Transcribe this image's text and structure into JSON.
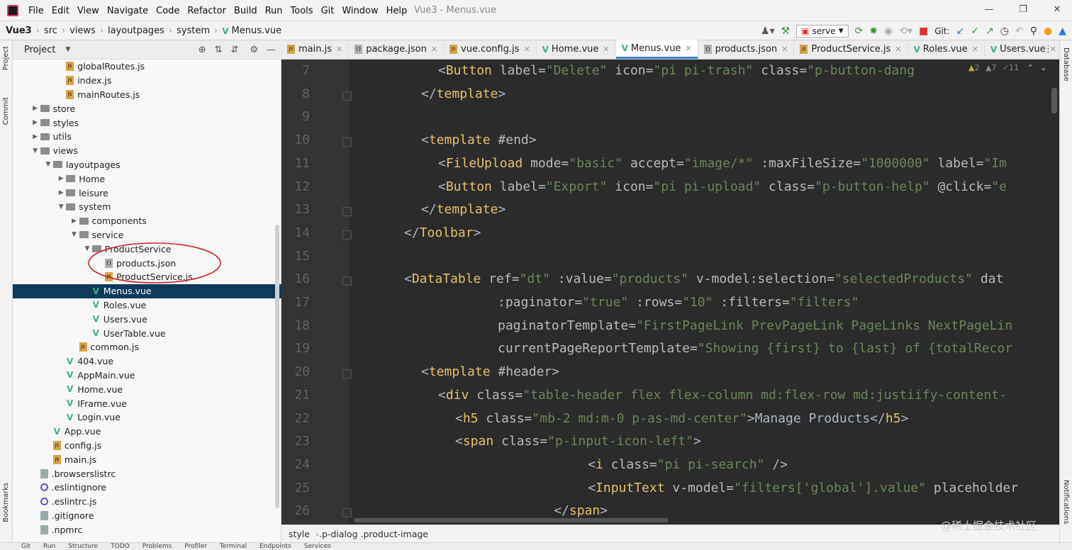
{
  "app": {
    "menu": [
      "File",
      "Edit",
      "View",
      "Navigate",
      "Code",
      "Refactor",
      "Build",
      "Run",
      "Tools",
      "Git",
      "Window",
      "Help"
    ],
    "window_title": "Vue3 - Menus.vue",
    "window_controls": [
      "minimize-icon",
      "restore-icon",
      "close-icon"
    ]
  },
  "breadcrumb": [
    "Vue3",
    "src",
    "views",
    "layoutpages",
    "system",
    "Menus.vue"
  ],
  "toolbar": {
    "run_config": "serve",
    "git_label": "Git:"
  },
  "project_panel": {
    "title": "Project",
    "tree": [
      {
        "label": "globalRoutes.js",
        "type": "js",
        "depth": 4
      },
      {
        "label": "index.js",
        "type": "js",
        "depth": 4
      },
      {
        "label": "mainRoutes.js",
        "type": "js",
        "depth": 4
      },
      {
        "label": "store",
        "type": "folder",
        "depth": 2,
        "expanded": false
      },
      {
        "label": "styles",
        "type": "folder",
        "depth": 2,
        "expanded": false
      },
      {
        "label": "utils",
        "type": "folder",
        "depth": 2,
        "expanded": false
      },
      {
        "label": "views",
        "type": "folder",
        "depth": 2,
        "expanded": true
      },
      {
        "label": "layoutpages",
        "type": "folder",
        "depth": 3,
        "expanded": true
      },
      {
        "label": "Home",
        "type": "folder",
        "depth": 4,
        "expanded": false
      },
      {
        "label": "leisure",
        "type": "folder",
        "depth": 4,
        "expanded": false
      },
      {
        "label": "system",
        "type": "folder",
        "depth": 4,
        "expanded": true
      },
      {
        "label": "components",
        "type": "folder",
        "depth": 5,
        "expanded": false
      },
      {
        "label": "service",
        "type": "folder",
        "depth": 5,
        "expanded": true
      },
      {
        "label": "ProductService",
        "type": "folder",
        "depth": 6,
        "expanded": true
      },
      {
        "label": "products.json",
        "type": "json",
        "depth": 7
      },
      {
        "label": "ProductService.js",
        "type": "js",
        "depth": 7
      },
      {
        "label": "Menus.vue",
        "type": "vue",
        "depth": 6,
        "selected": true
      },
      {
        "label": "Roles.vue",
        "type": "vue",
        "depth": 6
      },
      {
        "label": "Users.vue",
        "type": "vue",
        "depth": 6
      },
      {
        "label": "UserTable.vue",
        "type": "vue",
        "depth": 6
      },
      {
        "label": "common.js",
        "type": "js",
        "depth": 5
      },
      {
        "label": "404.vue",
        "type": "vue",
        "depth": 4
      },
      {
        "label": "AppMain.vue",
        "type": "vue",
        "depth": 4
      },
      {
        "label": "Home.vue",
        "type": "vue",
        "depth": 4
      },
      {
        "label": "IFrame.vue",
        "type": "vue",
        "depth": 4
      },
      {
        "label": "Login.vue",
        "type": "vue",
        "depth": 4
      },
      {
        "label": "App.vue",
        "type": "vue",
        "depth": 3
      },
      {
        "label": "config.js",
        "type": "js",
        "depth": 3
      },
      {
        "label": "main.js",
        "type": "js",
        "depth": 3
      },
      {
        "label": ".browserslistrc",
        "type": "dot",
        "depth": 2
      },
      {
        "label": ".eslintignore",
        "type": "eslint",
        "depth": 2
      },
      {
        "label": ".eslintrc.js",
        "type": "eslint",
        "depth": 2
      },
      {
        "label": ".gitignore",
        "type": "dot",
        "depth": 2
      },
      {
        "label": ".npmrc",
        "type": "dot",
        "depth": 2
      }
    ]
  },
  "tabs": [
    {
      "label": "main.js",
      "type": "js"
    },
    {
      "label": "package.json",
      "type": "json"
    },
    {
      "label": "vue.config.js",
      "type": "js"
    },
    {
      "label": "Home.vue",
      "type": "vue"
    },
    {
      "label": "Menus.vue",
      "type": "vue",
      "active": true
    },
    {
      "label": "products.json",
      "type": "json"
    },
    {
      "label": "ProductService.js",
      "type": "js"
    },
    {
      "label": "Roles.vue",
      "type": "vue"
    },
    {
      "label": "Users.vue",
      "type": "vue"
    }
  ],
  "inspection": {
    "warnings": "2",
    "weak": "7",
    "typos": "11"
  },
  "code_lines": [
    {
      "n": "7",
      "indent": 2,
      "t": [
        [
          "p",
          "<"
        ],
        [
          "tg",
          "Button "
        ],
        [
          "at",
          "label="
        ],
        [
          "st",
          "\"Delete\" "
        ],
        [
          "at",
          "icon="
        ],
        [
          "st",
          "\"pi pi-trash\" "
        ],
        [
          "at",
          "class="
        ],
        [
          "st",
          "\"p-button-dang"
        ]
      ]
    },
    {
      "n": "8",
      "indent": 1,
      "t": [
        [
          "p",
          "</"
        ],
        [
          "tg",
          "template"
        ],
        [
          "p",
          ">"
        ]
      ]
    },
    {
      "n": "9",
      "indent": 0,
      "t": []
    },
    {
      "n": "10",
      "indent": 1,
      "t": [
        [
          "p",
          "<"
        ],
        [
          "tg",
          "template "
        ],
        [
          "at",
          "#end"
        ],
        [
          "p",
          ">"
        ]
      ]
    },
    {
      "n": "11",
      "indent": 2,
      "t": [
        [
          "p",
          "<"
        ],
        [
          "tg",
          "FileUpload "
        ],
        [
          "at",
          "mode="
        ],
        [
          "st",
          "\"basic\" "
        ],
        [
          "at",
          "accept="
        ],
        [
          "st",
          "\"image/*\" "
        ],
        [
          "at",
          ":maxFileSize="
        ],
        [
          "st",
          "\"1000000\" "
        ],
        [
          "at",
          "label="
        ],
        [
          "st",
          "\"Im"
        ]
      ]
    },
    {
      "n": "12",
      "indent": 2,
      "t": [
        [
          "p",
          "<"
        ],
        [
          "tg",
          "Button "
        ],
        [
          "at",
          "label="
        ],
        [
          "st",
          "\"Export\" "
        ],
        [
          "at",
          "icon="
        ],
        [
          "st",
          "\"pi pi-upload\" "
        ],
        [
          "at",
          "class="
        ],
        [
          "st",
          "\"p-button-help\" "
        ],
        [
          "at",
          "@click="
        ],
        [
          "st",
          "\"e"
        ]
      ]
    },
    {
      "n": "13",
      "indent": 1,
      "t": [
        [
          "p",
          "</"
        ],
        [
          "tg",
          "template"
        ],
        [
          "p",
          ">"
        ]
      ]
    },
    {
      "n": "14",
      "indent": 0,
      "t": [
        [
          "p",
          "</"
        ],
        [
          "tg",
          "Toolbar"
        ],
        [
          "p",
          ">"
        ]
      ]
    },
    {
      "n": "15",
      "indent": 0,
      "t": []
    },
    {
      "n": "16",
      "indent": 0,
      "t": [
        [
          "p",
          "<"
        ],
        [
          "tg",
          "DataTable "
        ],
        [
          "at",
          "ref="
        ],
        [
          "st",
          "\"dt\" "
        ],
        [
          "at",
          ":value="
        ],
        [
          "st",
          "\"products\" "
        ],
        [
          "at",
          "v-model"
        ],
        [
          "p",
          ":"
        ],
        [
          "at",
          "selection="
        ],
        [
          "st",
          "\"selectedProducts\" "
        ],
        [
          "at",
          "dat"
        ]
      ]
    },
    {
      "n": "17",
      "indent": 5.5,
      "t": [
        [
          "at",
          ":paginator="
        ],
        [
          "st",
          "\"true\" "
        ],
        [
          "at",
          ":rows="
        ],
        [
          "st",
          "\"10\" "
        ],
        [
          "at",
          ":filters="
        ],
        [
          "st",
          "\"filters\""
        ]
      ]
    },
    {
      "n": "18",
      "indent": 5.5,
      "t": [
        [
          "at",
          "paginatorTemplate="
        ],
        [
          "st",
          "\"FirstPageLink PrevPageLink PageLinks NextPageLin"
        ]
      ]
    },
    {
      "n": "19",
      "indent": 5.5,
      "t": [
        [
          "at",
          "currentPageReportTemplate="
        ],
        [
          "st",
          "\"Showing {first} to {last} of {totalRecor"
        ]
      ]
    },
    {
      "n": "20",
      "indent": 1,
      "t": [
        [
          "p",
          "<"
        ],
        [
          "tg",
          "template "
        ],
        [
          "at",
          "#header"
        ],
        [
          "p",
          ">"
        ]
      ]
    },
    {
      "n": "21",
      "indent": 2,
      "t": [
        [
          "p",
          "<"
        ],
        [
          "tg",
          "div "
        ],
        [
          "at",
          "class="
        ],
        [
          "st",
          "\"table-header flex flex-column md:flex-row md:justiify-content-"
        ]
      ]
    },
    {
      "n": "22",
      "indent": 3,
      "t": [
        [
          "p",
          "<"
        ],
        [
          "tg",
          "h5 "
        ],
        [
          "at",
          "class="
        ],
        [
          "st",
          "\"mb-2 md:m-0 p-as-md-center\""
        ],
        [
          "p",
          ">Manage Products</"
        ],
        [
          "tg",
          "h5"
        ],
        [
          "p",
          ">"
        ]
      ]
    },
    {
      "n": "23",
      "indent": 3,
      "t": [
        [
          "p",
          "<"
        ],
        [
          "tg",
          "span "
        ],
        [
          "at",
          "class="
        ],
        [
          "st",
          "\"p-input-icon-left\""
        ],
        [
          "p",
          ">"
        ]
      ]
    },
    {
      "n": "24",
      "indent": 10.8,
      "t": [
        [
          "p",
          "<"
        ],
        [
          "tg",
          "i "
        ],
        [
          "at",
          "class="
        ],
        [
          "st",
          "\"pi pi-search\" "
        ],
        [
          "p",
          "/>"
        ]
      ]
    },
    {
      "n": "25",
      "indent": 10.8,
      "t": [
        [
          "p",
          "<"
        ],
        [
          "tg",
          "InputText "
        ],
        [
          "at",
          "v-model="
        ],
        [
          "st",
          "\"filters['global'].value\" "
        ],
        [
          "at",
          "placeholder"
        ]
      ]
    },
    {
      "n": "26",
      "indent": 8.8,
      "t": [
        [
          "p",
          "</"
        ],
        [
          "tg",
          "span"
        ],
        [
          "p",
          ">"
        ]
      ]
    }
  ],
  "status": {
    "path": [
      "style",
      ".p-dialog .product-image"
    ]
  },
  "left_strip": [
    "Project",
    "Commit",
    "Bookmarks"
  ],
  "right_strip": [
    "Database",
    "Notifications"
  ],
  "bottom_tools": [
    "Git",
    "Run",
    "Structure",
    "TODO",
    "Problems",
    "Profiler",
    "Terminal",
    "Endpoints",
    "Services"
  ],
  "watermark": "@稀土掘金技术社区"
}
